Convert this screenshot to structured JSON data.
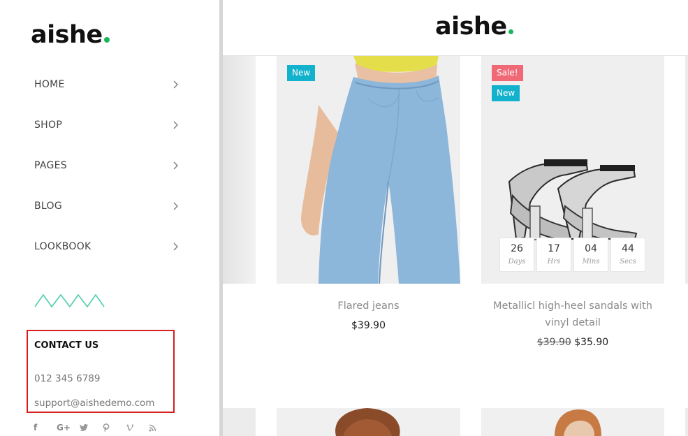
{
  "sidebar": {
    "logo": "aishe",
    "nav": [
      {
        "label": "HOME"
      },
      {
        "label": "SHOP"
      },
      {
        "label": "PAGES"
      },
      {
        "label": "BLOG"
      },
      {
        "label": "LOOKBOOK"
      }
    ],
    "contact": {
      "title": "CONTACT US",
      "phone": "012 345 6789",
      "email": "support@aishedemo.com"
    },
    "social": [
      "f",
      "G+",
      "t",
      "p",
      "v",
      "rss"
    ]
  },
  "header": {
    "logo": "aishe"
  },
  "products": [
    {
      "name": "Flared jeans",
      "price": "$39.90",
      "badges": [
        "New"
      ]
    },
    {
      "name_line1": "Metallicl high-heel sandals with",
      "name_line2": "vinyl detail",
      "old_price": "$39.90",
      "price": "$35.90",
      "badges": [
        "Sale!",
        "New"
      ],
      "countdown": [
        {
          "value": "26",
          "label": "Days"
        },
        {
          "value": "17",
          "label": "Hrs"
        },
        {
          "value": "04",
          "label": "Mins"
        },
        {
          "value": "44",
          "label": "Secs"
        }
      ]
    }
  ],
  "colors": {
    "brand_dot": "#1ab55a",
    "badge_new": "#12b1cc",
    "badge_sale": "#ef6a76",
    "highlight_border": "#d81e1e",
    "zigzag": "#4ecdb0"
  }
}
